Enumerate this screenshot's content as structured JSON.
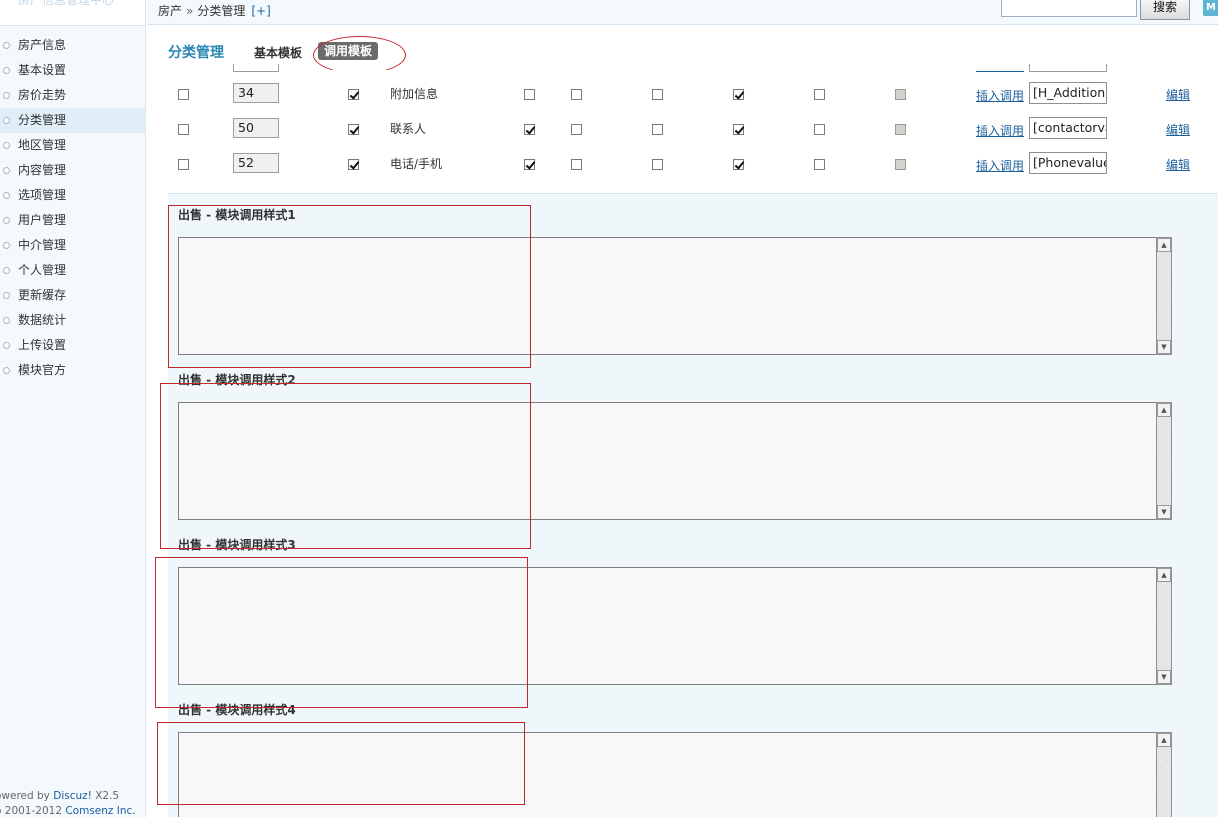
{
  "sidebar": {
    "header_text": "房产信息管理中心",
    "items": [
      {
        "label": "房产信息"
      },
      {
        "label": "基本设置"
      },
      {
        "label": "房价走势"
      },
      {
        "label": "分类管理"
      },
      {
        "label": "地区管理"
      },
      {
        "label": "内容管理"
      },
      {
        "label": "选项管理"
      },
      {
        "label": "用户管理"
      },
      {
        "label": "中介管理"
      },
      {
        "label": "个人管理"
      },
      {
        "label": "更新缓存"
      },
      {
        "label": "数据统计"
      },
      {
        "label": "上传设置"
      },
      {
        "label": "模块官方"
      }
    ],
    "active_index": 3,
    "footer_line1_prefix": "owered by ",
    "footer_brand": "Discuz!",
    "footer_version": " X2.5",
    "footer_line2_prefix": "o 2001-2012 ",
    "footer_company": "Comsenz Inc."
  },
  "topbar": {
    "breadcrumb_root": "房产",
    "breadcrumb_sep": "»",
    "breadcrumb_current": "分类管理",
    "breadcrumb_add": "[+]",
    "search_value": "",
    "search_button": "搜索",
    "mini_icon_letter": "M"
  },
  "tabs": {
    "section_title": "分类管理",
    "basic_template": "基本模板",
    "call_template": "调用模板"
  },
  "rows": [
    {
      "order": "34",
      "name": "附加信息",
      "checks": [
        false,
        true,
        false,
        false,
        false,
        true,
        false,
        true
      ],
      "insert_label": "插入调用",
      "tag": "[H_Addition",
      "edit_label": "编辑"
    },
    {
      "order": "50",
      "name": "联系人",
      "checks": [
        false,
        true,
        true,
        false,
        false,
        true,
        false,
        true
      ],
      "insert_label": "插入调用",
      "tag": "[contactorva",
      "edit_label": "编辑"
    },
    {
      "order": "52",
      "name": "电话/手机",
      "checks": [
        false,
        true,
        true,
        false,
        false,
        true,
        false,
        true
      ],
      "insert_label": "插入调用",
      "tag": "[Phonevalue",
      "edit_label": "编辑"
    }
  ],
  "styles": [
    {
      "label": "出售 - 模块调用样式1",
      "value": ""
    },
    {
      "label": "出售 - 模块调用样式2",
      "value": ""
    },
    {
      "label": "出售 - 模块调用样式3",
      "value": ""
    },
    {
      "label": "出售 - 模块调用样式4",
      "value": ""
    }
  ],
  "colors": {
    "accent": "#2a86b5",
    "highlight_red": "#c0282d",
    "link": "#1b5f9c",
    "sidebar_bg": "#f4f9fd",
    "active_bg": "#dfeef7"
  }
}
